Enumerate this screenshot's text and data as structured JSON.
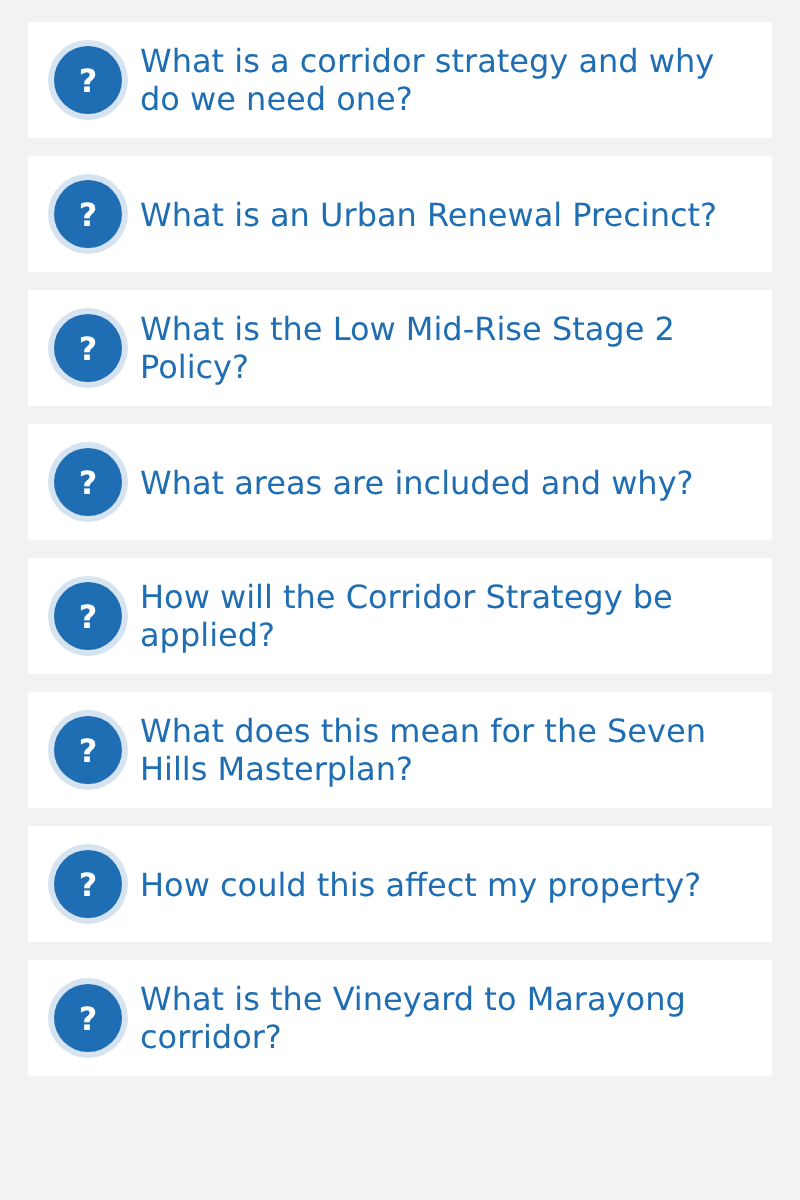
{
  "faq_items": [
    {
      "icon": "?",
      "question": "What is a corridor strategy and why do we need one?"
    },
    {
      "icon": "?",
      "question": "What is an Urban Renewal Precinct?"
    },
    {
      "icon": "?",
      "question": "What is the Low Mid-Rise Stage 2 Policy?"
    },
    {
      "icon": "?",
      "question": "What areas are included and why?"
    },
    {
      "icon": "?",
      "question": "How will the Corridor Strategy be applied?"
    },
    {
      "icon": "?",
      "question": "What does this mean for the Seven Hills Masterplan?"
    },
    {
      "icon": "?",
      "question": "How could this affect my property?"
    },
    {
      "icon": "?",
      "question": "What is the Vineyard to Marayong corridor?"
    }
  ]
}
